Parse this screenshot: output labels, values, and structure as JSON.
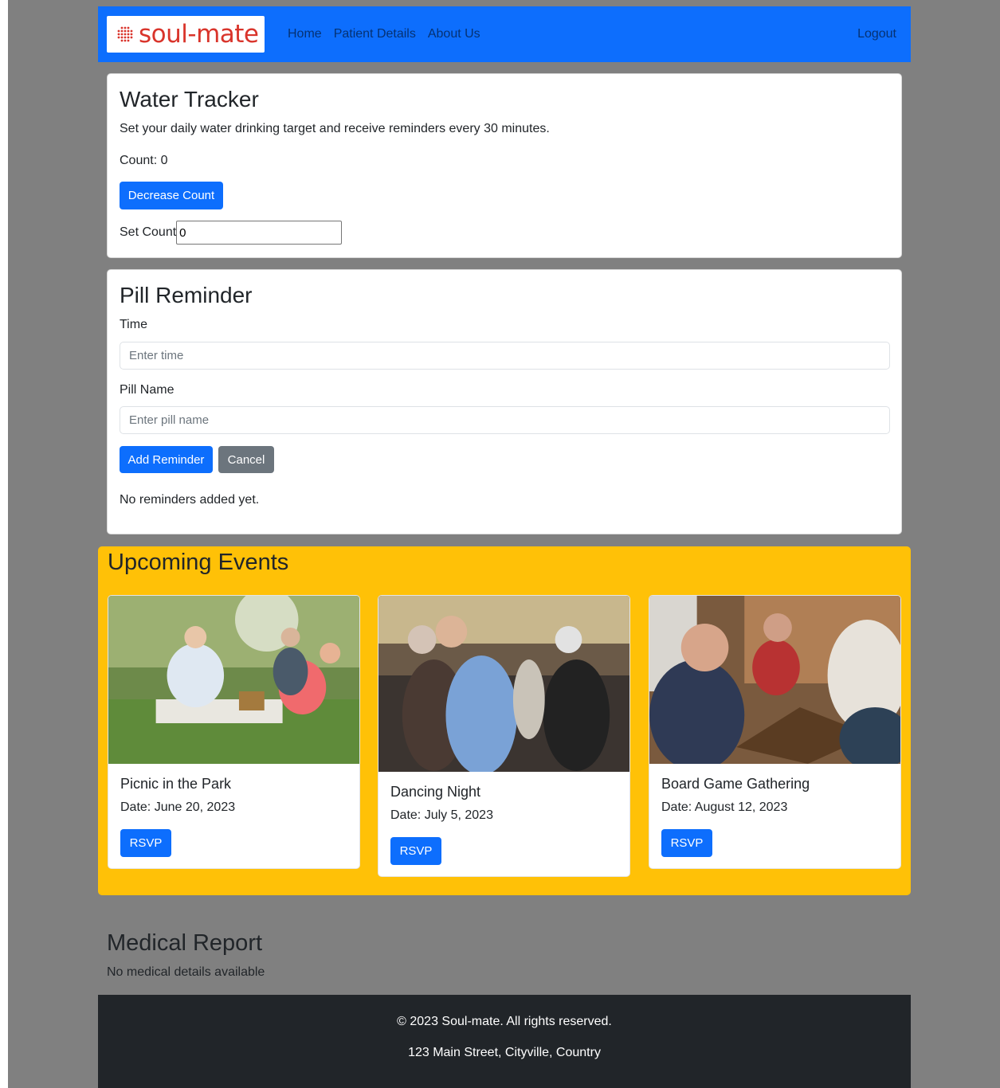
{
  "brand": {
    "name": "soul-mate",
    "color": "#d9342b"
  },
  "nav": {
    "links": [
      {
        "label": "Home"
      },
      {
        "label": "Patient Details"
      },
      {
        "label": "About Us"
      }
    ],
    "logout": "Logout"
  },
  "water": {
    "title": "Water Tracker",
    "description": "Set your daily water drinking target and receive reminders every 30 minutes.",
    "count_text": "Count: 0",
    "decrease_label": "Decrease Count",
    "set_count_label": "Set Count",
    "set_count_value": "0"
  },
  "pill": {
    "title": "Pill Reminder",
    "time_label": "Time",
    "time_placeholder": "Enter time",
    "name_label": "Pill Name",
    "name_placeholder": "Enter pill name",
    "add_label": "Add Reminder",
    "cancel_label": "Cancel",
    "empty_text": "No reminders added yet."
  },
  "events": {
    "title": "Upcoming Events",
    "items": [
      {
        "title": "Picnic in the Park",
        "date": "Date: June 20, 2023",
        "rsvp": "RSVP",
        "photo": "picnic-photo"
      },
      {
        "title": "Dancing Night",
        "date": "Date: July 5, 2023",
        "rsvp": "RSVP",
        "photo": "dancing-photo"
      },
      {
        "title": "Board Game Gathering",
        "date": "Date: August 12, 2023",
        "rsvp": "RSVP",
        "photo": "chess-photo"
      }
    ]
  },
  "medical": {
    "title": "Medical Report",
    "text": "No medical details available"
  },
  "footer": {
    "copyright": "© 2023 Soul-mate. All rights reserved.",
    "address": "123 Main Street, Cityville, Country"
  },
  "colors": {
    "primary": "#0d6efd",
    "secondary": "#6c757d",
    "warning": "#ffc107",
    "dark": "#212529",
    "page_bg": "#808080"
  }
}
